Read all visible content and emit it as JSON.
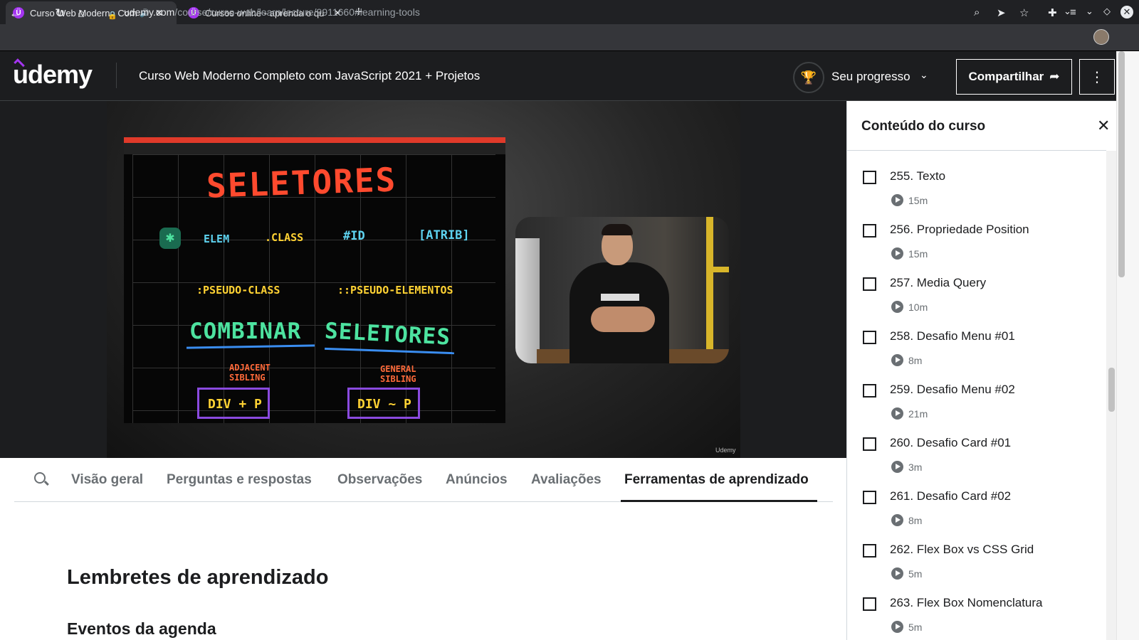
{
  "browser": {
    "tabs": [
      {
        "title": "Curso Web Moderno Com",
        "active": true,
        "audio": true
      },
      {
        "title": "Cursos online - aprenda o qu",
        "active": false
      }
    ],
    "address": {
      "host": "udemy.com",
      "path": "/course/curso-web/learn/lecture/9911660#learning-tools"
    }
  },
  "header": {
    "logo": "udemy",
    "course_title": "Curso Web Moderno Completo com JavaScript 2021 + Projetos",
    "progress_label": "Seu progresso",
    "share_label": "Compartilhar"
  },
  "video": {
    "board": {
      "title": "SELETORES",
      "items": [
        "ELEM",
        ".CLASS",
        "#ID",
        "[ATRIB]",
        ":PSEUDO-CLASS",
        "::PSEUDO-ELEMENTOS"
      ],
      "combine": [
        "COMBINAR",
        "SELETORES"
      ],
      "notes": [
        "ADJACENT SIBLING",
        "GENERAL SIBLING"
      ],
      "boxes": [
        "DIV + P",
        "DIV ~ P"
      ]
    },
    "watermark": "Udemy"
  },
  "tabs": [
    "Visão geral",
    "Perguntas e respostas",
    "Observações",
    "Anúncios",
    "Avaliações",
    "Ferramentas de aprendizado"
  ],
  "content": {
    "heading": "Lembretes de aprendizado",
    "subheading": "Eventos da agenda"
  },
  "sidebar": {
    "title": "Conteúdo do curso",
    "lessons": [
      {
        "name": "255. Texto",
        "duration": "15m"
      },
      {
        "name": "256. Propriedade Position",
        "duration": "15m"
      },
      {
        "name": "257. Media Query",
        "duration": "10m"
      },
      {
        "name": "258. Desafio Menu #01",
        "duration": "8m"
      },
      {
        "name": "259. Desafio Menu #02",
        "duration": "21m"
      },
      {
        "name": "260. Desafio Card #01",
        "duration": "3m"
      },
      {
        "name": "261. Desafio Card #02",
        "duration": "8m"
      },
      {
        "name": "262. Flex Box vs CSS Grid",
        "duration": "5m"
      },
      {
        "name": "263. Flex Box Nomenclatura",
        "duration": "5m"
      }
    ]
  }
}
